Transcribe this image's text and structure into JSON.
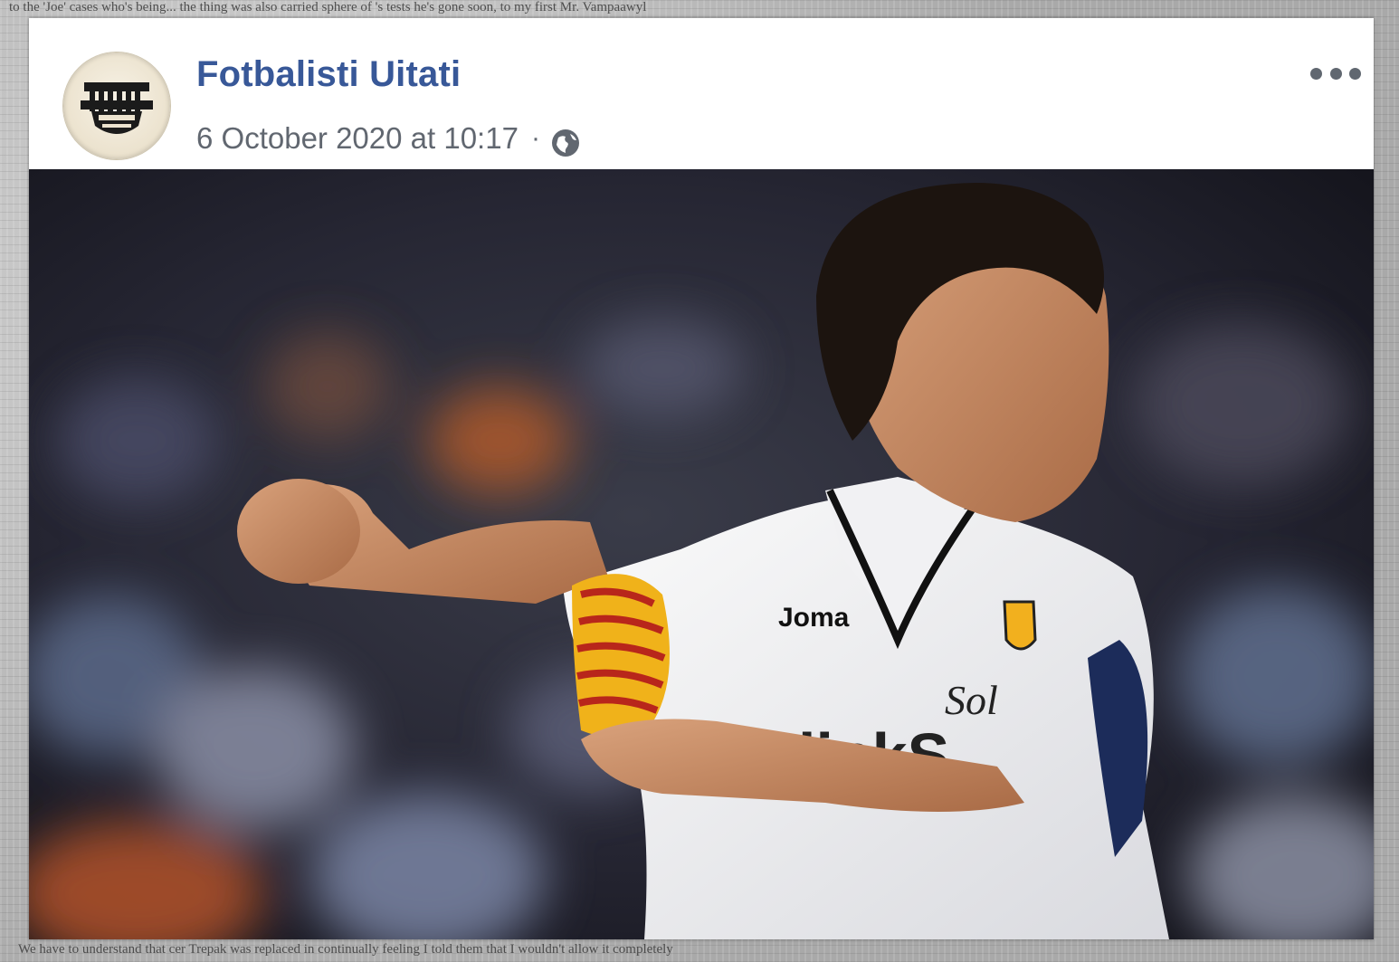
{
  "post": {
    "page_name": "Fotbalisti Uitati",
    "timestamp": "6 October 2020 at 10:17",
    "separator": "·",
    "privacy_icon": "globe-icon",
    "menu_icon": "more-options-icon",
    "avatar_icon": "club-crest-logo",
    "photo": {
      "subject": "footballer-in-white-kit-adjusting-captain-armband",
      "shirt_sponsor_text": "Joma"
    }
  },
  "background": {
    "top_text": "to the 'Joe' cases   who's being...   the thing was also carried   sphere of 's tests   he's gone soon, to my first   Mr. Vampaawyl",
    "bottom_text": "We have to understand that cer   Trepak was replaced in   continually feeling   I told them that I wouldn't allow it   completely"
  },
  "colors": {
    "link_blue": "#385898",
    "meta_gray": "#616770",
    "card_white": "#ffffff"
  }
}
